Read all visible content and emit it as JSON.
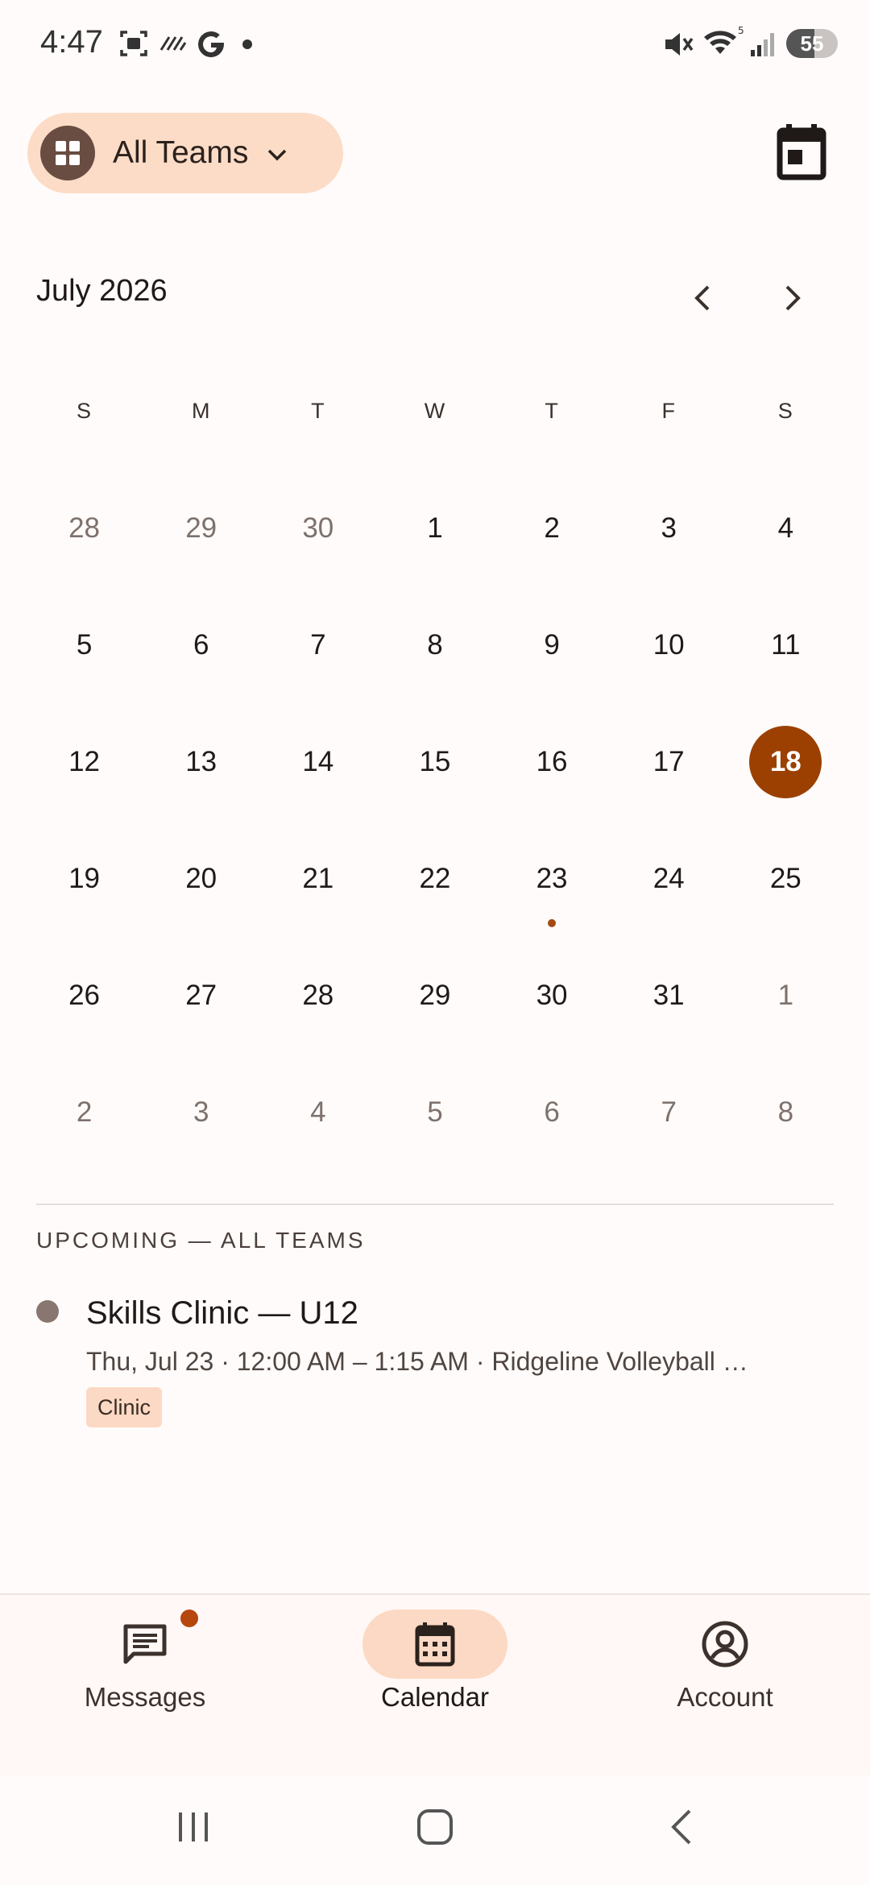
{
  "status_bar": {
    "time": "4:47",
    "battery": "55",
    "battery_level": 0.55,
    "icons": [
      "screenshot-icon",
      "nfc-icon",
      "google-icon",
      "dot-icon",
      "mute-icon",
      "wifi-icon",
      "signal-icon",
      "battery-icon"
    ]
  },
  "header": {
    "team_label": "All Teams",
    "team_icon": "grid-icon",
    "calendar_icon": "calendar-icon"
  },
  "calendar": {
    "month_title": "July 2026",
    "weekdays": [
      "S",
      "M",
      "T",
      "W",
      "T",
      "F",
      "S"
    ],
    "weeks": [
      [
        {
          "d": "28",
          "muted": true
        },
        {
          "d": "29",
          "muted": true
        },
        {
          "d": "30",
          "muted": true
        },
        {
          "d": "1"
        },
        {
          "d": "2"
        },
        {
          "d": "3"
        },
        {
          "d": "4"
        }
      ],
      [
        {
          "d": "5"
        },
        {
          "d": "6"
        },
        {
          "d": "7"
        },
        {
          "d": "8"
        },
        {
          "d": "9"
        },
        {
          "d": "10"
        },
        {
          "d": "11"
        }
      ],
      [
        {
          "d": "12"
        },
        {
          "d": "13"
        },
        {
          "d": "14"
        },
        {
          "d": "15"
        },
        {
          "d": "16"
        },
        {
          "d": "17"
        },
        {
          "d": "18",
          "today": true
        }
      ],
      [
        {
          "d": "19"
        },
        {
          "d": "20"
        },
        {
          "d": "21"
        },
        {
          "d": "22"
        },
        {
          "d": "23",
          "event": true
        },
        {
          "d": "24"
        },
        {
          "d": "25"
        }
      ],
      [
        {
          "d": "26"
        },
        {
          "d": "27"
        },
        {
          "d": "28"
        },
        {
          "d": "29"
        },
        {
          "d": "30"
        },
        {
          "d": "31"
        },
        {
          "d": "1",
          "muted": true
        }
      ],
      [
        {
          "d": "2",
          "muted": true
        },
        {
          "d": "3",
          "muted": true
        },
        {
          "d": "4",
          "muted": true
        },
        {
          "d": "5",
          "muted": true
        },
        {
          "d": "6",
          "muted": true
        },
        {
          "d": "7",
          "muted": true
        },
        {
          "d": "8",
          "muted": true
        }
      ]
    ],
    "accent_color": "#9b4000"
  },
  "upcoming": {
    "title": "UPCOMING — ALL TEAMS",
    "events": [
      {
        "title": "Skills Clinic — U12",
        "subtitle": "Thu, Jul 23 · 12:00 AM – 1:15 AM · Ridgeline Volleyball …",
        "tag": "Clinic"
      }
    ]
  },
  "bottom_nav": {
    "items": [
      {
        "label": "Messages",
        "icon": "message-icon",
        "badge": true
      },
      {
        "label": "Calendar",
        "icon": "calendar-icon",
        "active": true
      },
      {
        "label": "Account",
        "icon": "account-icon"
      }
    ]
  },
  "system_nav": [
    "recents-icon",
    "home-icon",
    "back-icon"
  ]
}
